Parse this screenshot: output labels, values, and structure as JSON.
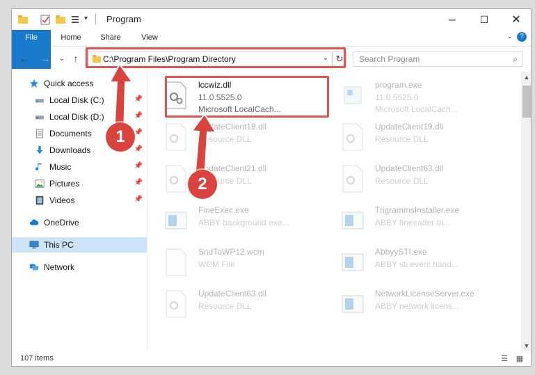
{
  "window": {
    "title": "Program"
  },
  "ribbon": {
    "tabs": [
      "File",
      "Home",
      "Share",
      "View"
    ]
  },
  "address": {
    "path": "C:\\Program Files\\Program Directory"
  },
  "search": {
    "placeholder": "Search Program"
  },
  "sidebar": {
    "items": [
      {
        "label": "Quick access",
        "icon": "star-icon"
      },
      {
        "label": "Local Disk (C:)",
        "icon": "drive-icon"
      },
      {
        "label": "Local Disk (D:)",
        "icon": "drive-icon"
      },
      {
        "label": "Documents",
        "icon": "documents-icon"
      },
      {
        "label": "Downloads",
        "icon": "download-icon"
      },
      {
        "label": "Music",
        "icon": "music-icon"
      },
      {
        "label": "Pictures",
        "icon": "pictures-icon"
      },
      {
        "label": "Videos",
        "icon": "videos-icon"
      },
      {
        "label": "OneDrive",
        "icon": "cloud-icon"
      },
      {
        "label": "This PC",
        "icon": "computer-icon"
      },
      {
        "label": "Network",
        "icon": "network-icon"
      }
    ]
  },
  "files": [
    {
      "name": "lccwiz.dll",
      "line2": "11.0.5525.0",
      "line3": "Microsoft LocalCach..."
    },
    {
      "name": "program.exe",
      "line2": "11.0.5525.0",
      "line3": "Microsoft LocalCach..."
    },
    {
      "name": "UpdateClient19.dll",
      "line2": "Resource DLL",
      "line3": ""
    },
    {
      "name": "UpdateClient19.dll",
      "line2": "Resource DLL",
      "line3": ""
    },
    {
      "name": "UpdateClient21.dll",
      "line2": "Resource DLL",
      "line3": ""
    },
    {
      "name": "UpdateClient63.dll",
      "line2": "Resource DLL",
      "line3": ""
    },
    {
      "name": "FineExec.exe",
      "line2": "ABBY background exe...",
      "line3": ""
    },
    {
      "name": "TrigrammsInstaller.exe",
      "line2": "ABBY fineeader tri...",
      "line3": ""
    },
    {
      "name": "SndToWP12.wcm",
      "line2": "WCM File",
      "line3": ""
    },
    {
      "name": "AbbyySTI.exe",
      "line2": "ABBY sti event hand...",
      "line3": ""
    },
    {
      "name": "UpdateClient63.dll",
      "line2": "Resource DLL",
      "line3": ""
    },
    {
      "name": "NetworkLicenseServer.exe",
      "line2": "ABBY network licens...",
      "line3": ""
    }
  ],
  "status": {
    "items_count": "107 items"
  },
  "annotations": {
    "badge1": "1",
    "badge2": "2"
  },
  "colors": {
    "accent": "#1979ca",
    "highlight": "#e15353",
    "selected": "#cce4f7"
  }
}
